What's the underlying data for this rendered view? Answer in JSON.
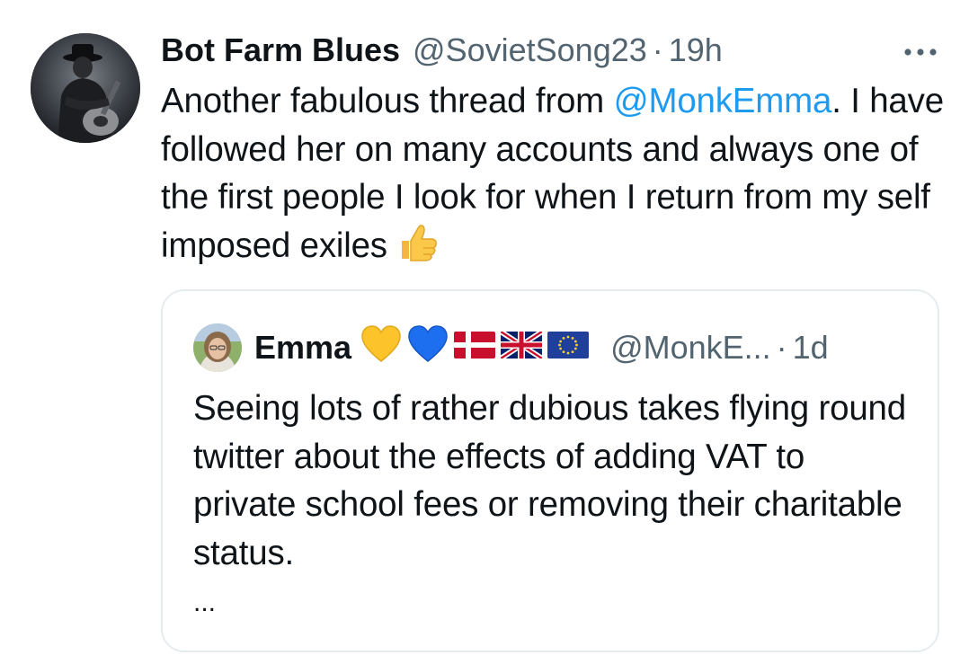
{
  "tweet": {
    "display_name": "Bot Farm Blues",
    "handle": "@SovietSong23",
    "separator": "·",
    "time": "19h",
    "more_icon": "more-horizontal-icon",
    "text_part1": "Another fabulous thread from ",
    "mention": "@MonkEmma",
    "text_part2": ".  I have followed her on many accounts and always one of the first people I look for when I return from my self imposed exiles",
    "emoji": "thumbs-up-emoji"
  },
  "quote": {
    "display_name": "Emma",
    "name_emojis": [
      "yellow-heart-emoji",
      "blue-heart-emoji",
      "denmark-flag-emoji",
      "uk-flag-emoji",
      "eu-flag-emoji"
    ],
    "handle": "@MonkE...",
    "separator": "·",
    "time": "1d",
    "text": "Seeing lots of rather dubious takes flying round twitter about the effects of adding VAT to private school fees or removing their charitable status.",
    "ellipsis": "..."
  },
  "colors": {
    "text": "#0f1419",
    "secondary": "#536471",
    "link": "#1d9bf0",
    "border": "#e6ebee"
  }
}
